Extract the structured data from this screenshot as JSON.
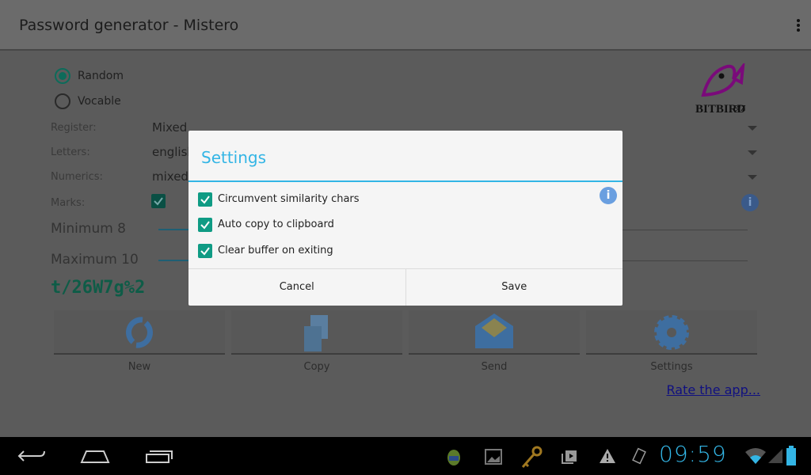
{
  "app": {
    "title": "Password generator - Mistero",
    "menu_icon": "overflow-menu-icon"
  },
  "logo": {
    "text": "BITBIRD.BIZ",
    "color": "#7a0a7a"
  },
  "mode": {
    "options": [
      {
        "label": "Random",
        "selected": true
      },
      {
        "label": "Vocable",
        "selected": false
      }
    ]
  },
  "form": {
    "register": {
      "label": "Register:",
      "value": "Mixed"
    },
    "letters": {
      "label": "Letters:",
      "value": "english"
    },
    "numerics": {
      "label": "Numerics:",
      "value": "mixed"
    },
    "marks": {
      "label": "Marks:",
      "checked": true
    },
    "minimum": {
      "label": "Minimum 8",
      "value": 8
    },
    "maximum": {
      "label": "Maximum 10",
      "value": 10
    }
  },
  "password": "t/26W7g%2",
  "actions": [
    {
      "label": "New",
      "icon": "refresh-icon"
    },
    {
      "label": "Copy",
      "icon": "copy-icon"
    },
    {
      "label": "Send",
      "icon": "envelope-icon"
    },
    {
      "label": "Settings",
      "icon": "gear-icon"
    }
  ],
  "rate_link": "Rate the app...",
  "dialog": {
    "title": "Settings",
    "options": [
      {
        "label": "Circumvent similarity chars",
        "checked": true
      },
      {
        "label": "Auto copy to clipboard",
        "checked": true
      },
      {
        "label": "Clear buffer on exiting",
        "checked": true
      }
    ],
    "cancel": "Cancel",
    "save": "Save"
  },
  "statusbar": {
    "time": "09:59",
    "icons": [
      "android-icon",
      "gallery-icon",
      "key-icon",
      "store-icon",
      "warning-icon",
      "rotation-icon",
      "wifi-icon",
      "signal-icon",
      "battery-icon"
    ]
  },
  "colors": {
    "accent": "#33b5e5",
    "checkbox": "#0f9b84",
    "password": "#0e5c47"
  }
}
